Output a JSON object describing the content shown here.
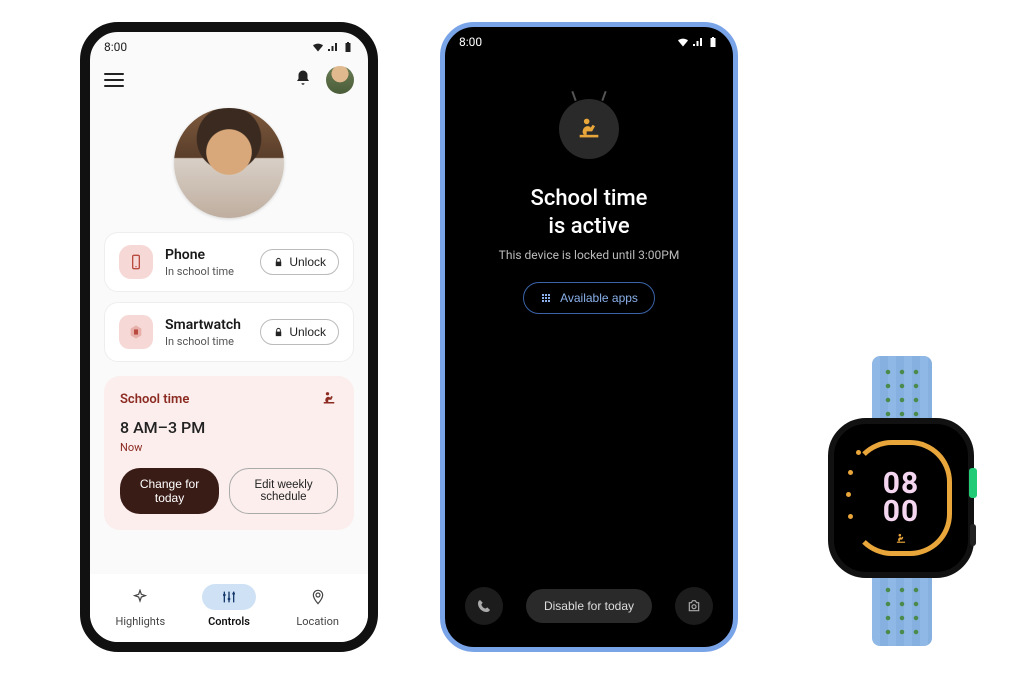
{
  "phone1": {
    "status_time": "8:00",
    "devices": [
      {
        "title": "Phone",
        "sub": "In school time",
        "unlock": "Unlock"
      },
      {
        "title": "Smartwatch",
        "sub": "In school time",
        "unlock": "Unlock"
      }
    ],
    "school": {
      "title": "School time",
      "range": "8 AM–3 PM",
      "now": "Now",
      "change": "Change for today",
      "edit": "Edit weekly schedule"
    },
    "nav": {
      "highlights": "Highlights",
      "controls": "Controls",
      "location": "Location"
    }
  },
  "phone2": {
    "status_time": "8:00",
    "heading_line1": "School time",
    "heading_line2": "is active",
    "sub": "This device is locked until 3:00PM",
    "available": "Available apps",
    "disable": "Disable for today"
  },
  "watch": {
    "hour": "08",
    "minute": "00"
  }
}
